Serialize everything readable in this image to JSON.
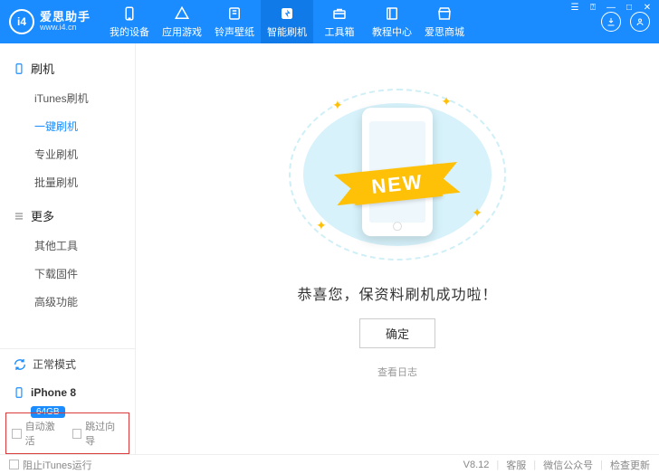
{
  "brand": {
    "name": "爱思助手",
    "url": "www.i4.cn",
    "logo_letters": "i4"
  },
  "top_tabs": [
    {
      "label": "我的设备",
      "icon": "device"
    },
    {
      "label": "应用游戏",
      "icon": "apps"
    },
    {
      "label": "铃声壁纸",
      "icon": "music"
    },
    {
      "label": "智能刷机",
      "icon": "flash",
      "active": true
    },
    {
      "label": "工具箱",
      "icon": "toolbox"
    },
    {
      "label": "教程中心",
      "icon": "book"
    },
    {
      "label": "爱思商城",
      "icon": "store"
    }
  ],
  "sidebar": {
    "cat1": {
      "label": "刷机",
      "items": [
        "iTunes刷机",
        "一键刷机",
        "专业刷机",
        "批量刷机"
      ],
      "active_index": 1
    },
    "cat2": {
      "label": "更多",
      "items": [
        "其他工具",
        "下载固件",
        "高级功能"
      ]
    },
    "mode": "正常模式",
    "device": {
      "name": "iPhone 8",
      "storage": "64GB"
    },
    "checks": {
      "auto_activate": "自动激活",
      "skip_guide": "跳过向导"
    }
  },
  "main": {
    "ribbon": "NEW",
    "success": "恭喜您，保资料刷机成功啦！",
    "ok": "确定",
    "log": "查看日志"
  },
  "status": {
    "block_itunes": "阻止iTunes运行",
    "version": "V8.12",
    "support": "客服",
    "wechat": "微信公众号",
    "update": "检查更新"
  }
}
